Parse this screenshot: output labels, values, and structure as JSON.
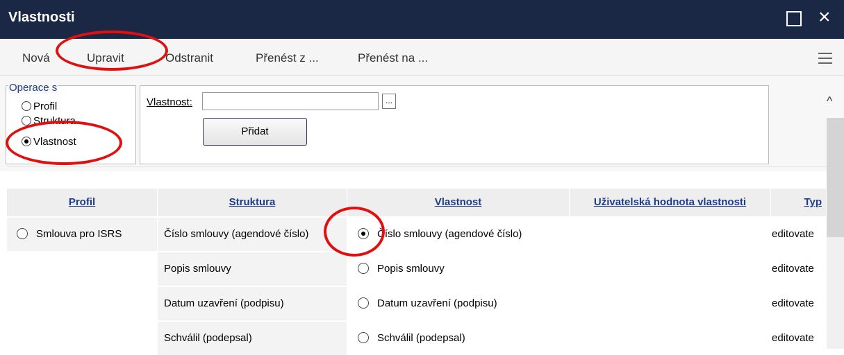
{
  "window": {
    "title": "Vlastnosti"
  },
  "menu": {
    "items": [
      "Nová",
      "Upravit",
      "Odstranit",
      "Přenést z ...",
      "Přenést na ..."
    ]
  },
  "operation": {
    "legend": "Operace s",
    "options": [
      {
        "label": "Profil",
        "checked": false
      },
      {
        "label": "Struktura",
        "checked": false
      },
      {
        "label": "Vlastnost",
        "checked": true
      }
    ]
  },
  "property_form": {
    "label": "Vlastnost:",
    "value": "",
    "browse_label": "...",
    "add_label": "Přidat"
  },
  "table": {
    "headers": [
      "Profil",
      "Struktura",
      "Vlastnost",
      "Uživatelská hodnota vlastnosti",
      "Typ"
    ],
    "rows": [
      {
        "profil": "Smlouva pro ISRS",
        "profil_radio": true,
        "struktura": "Číslo smlouvy (agendové číslo)",
        "vlastnost": "Číslo smlouvy (agendové číslo)",
        "vlastnost_checked": true,
        "hodnota": "",
        "typ": "editovate"
      },
      {
        "profil": "",
        "profil_radio": false,
        "struktura": "Popis smlouvy",
        "vlastnost": "Popis smlouvy",
        "vlastnost_checked": false,
        "hodnota": "",
        "typ": "editovate"
      },
      {
        "profil": "",
        "profil_radio": false,
        "struktura": "Datum uzavření (podpisu)",
        "vlastnost": "Datum uzavření (podpisu)",
        "vlastnost_checked": false,
        "hodnota": "",
        "typ": "editovate"
      },
      {
        "profil": "",
        "profil_radio": false,
        "struktura": "Schválil (podepsal)",
        "vlastnost": "Schválil (podepsal)",
        "vlastnost_checked": false,
        "hodnota": "",
        "typ": "editovate"
      }
    ]
  },
  "colors": {
    "titlebar": "#1b2845",
    "header_link": "#1f3c88",
    "annotation": "#e01010"
  }
}
